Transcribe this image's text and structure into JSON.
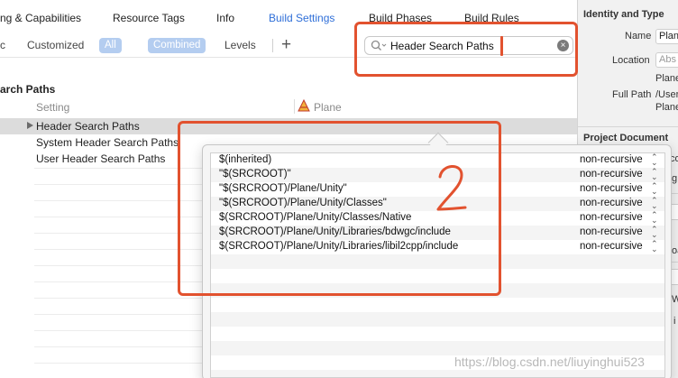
{
  "tabs": [
    {
      "label": "ng & Capabilities",
      "active": false
    },
    {
      "label": "Resource Tags",
      "active": false
    },
    {
      "label": "Info",
      "active": false
    },
    {
      "label": "Build Settings",
      "active": true
    },
    {
      "label": "Build Phases",
      "active": false
    },
    {
      "label": "Build Rules",
      "active": false
    }
  ],
  "filter": {
    "left_fragment": "c",
    "customized": "Customized",
    "all": "All",
    "combined": "Combined",
    "levels": "Levels",
    "add": "+"
  },
  "search": {
    "value": "Header Search Paths",
    "icon": "search-icon",
    "clear_icon": "clear-icon"
  },
  "section": {
    "title": "arch Paths",
    "column_setting": "Setting",
    "column_target": "Plane"
  },
  "settings_rows": [
    {
      "label": "Header Search Paths",
      "expandable": true,
      "selected": true
    },
    {
      "label": "System Header Search Paths",
      "expandable": false,
      "selected": false
    },
    {
      "label": "User Header Search Paths",
      "expandable": false,
      "selected": false
    }
  ],
  "popover": {
    "rows": [
      {
        "path": "$(inherited)",
        "recursion": "non-recursive"
      },
      {
        "path": "\"$(SRCROOT)\"",
        "recursion": "non-recursive"
      },
      {
        "path": "\"$(SRCROOT)/Plane/Unity\"",
        "recursion": "non-recursive"
      },
      {
        "path": "\"$(SRCROOT)/Plane/Unity/Classes\"",
        "recursion": "non-recursive"
      },
      {
        "path": "$(SRCROOT)/Plane/Unity/Classes/Native",
        "recursion": "non-recursive"
      },
      {
        "path": "$(SRCROOT)/Plane/Unity/Libraries/bdwgc/include",
        "recursion": "non-recursive"
      },
      {
        "path": "$(SRCROOT)/Plane/Unity/Libraries/libil2cpp/include",
        "recursion": "non-recursive"
      }
    ],
    "stepper_up": "⌃",
    "stepper_down": "⌄"
  },
  "inspector": {
    "identity_title": "Identity and Type",
    "name_label": "Name",
    "name_value": "Plan",
    "location_label": "Location",
    "location_value": "Abs",
    "location_sub": "Plane",
    "fullpath_label": "Full Path",
    "fullpath_value": "/User",
    "fullpath_sub": "Plane",
    "project_doc_title": "Project Document",
    "partial_1": "co",
    "partial_2": "g",
    "partial_3": "oa",
    "partial_4": "W",
    "partial_5": "i"
  },
  "annotation": {
    "number": "2",
    "color": "#e2522f"
  },
  "watermark": "https://blog.csdn.net/liuyinghui523"
}
